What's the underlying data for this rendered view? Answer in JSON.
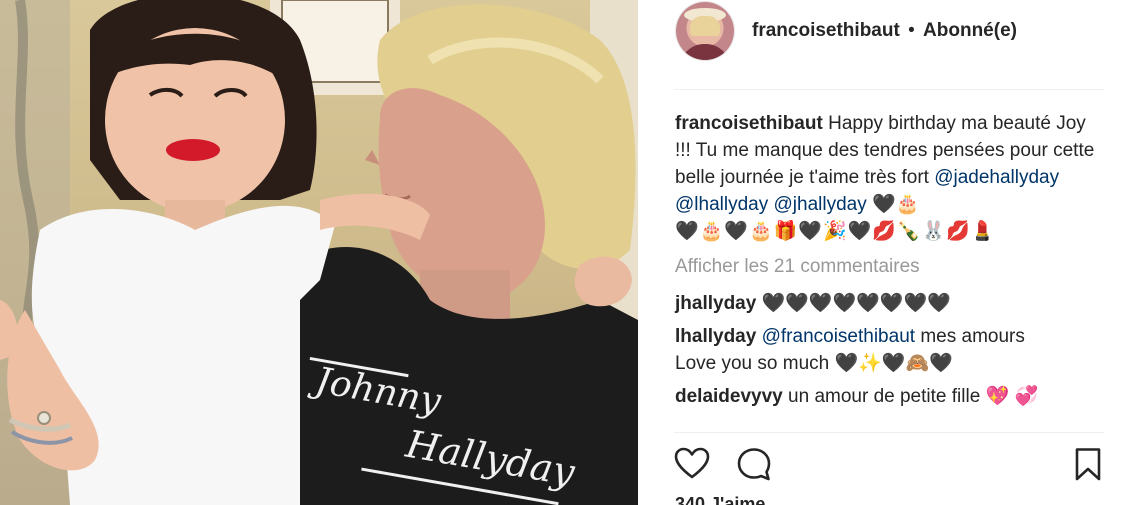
{
  "photo": {
    "tshirt_text_line1": "Johnny",
    "tshirt_text_line2": "Hallyday"
  },
  "post": {
    "author": "francoisethibaut",
    "separator": "•",
    "follow_status": "Abonné(e)",
    "caption": {
      "user": "francoisethibaut",
      "text": "Happy birthday ma beauté Joy !!! Tu me manque des tendres pensées pour cette belle journée je t'aime très fort",
      "mentions": [
        "@jadehallyday",
        "@lhallyday",
        "@jhallyday"
      ],
      "emoji_tail": "🖤🎂",
      "emoji_line": "🖤🎂🖤🎂🎁🖤🎉🖤💋🍾🐰💋💄"
    },
    "view_all_comments": "Afficher les 21 commentaires",
    "comments": [
      {
        "user": "jhallyday",
        "text": "🖤🖤🖤🖤🖤🖤🖤🖤"
      },
      {
        "user": "lhallyday",
        "mention": "@francoisethibaut",
        "text": "mes amours",
        "line2": "Love you so much 🖤✨🖤🙈🖤"
      },
      {
        "user": "delaidevyvy",
        "text": "un amour de petite fille 💖 💞"
      }
    ],
    "likes_partial": "340 J'aime"
  },
  "icons": {
    "like": "heart-icon",
    "comment": "comment-bubble-icon",
    "save": "bookmark-icon"
  },
  "colors": {
    "text": "#262626",
    "mention": "#003569",
    "muted": "#999999",
    "divider": "#efefef"
  }
}
